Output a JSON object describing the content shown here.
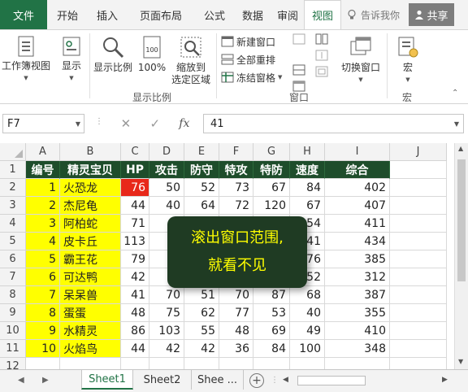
{
  "tabs": {
    "file": "文件",
    "items": [
      "开始",
      "插入",
      "页面布局",
      "公式",
      "数据",
      "审阅",
      "视图"
    ],
    "active": "视图",
    "tell_me": "告诉我你",
    "share": "共享"
  },
  "ribbon": {
    "workbook_views": "工作簿视图",
    "show": "显示",
    "zoom": "显示比例",
    "zoom_100": "100%",
    "zoom_to_selection": [
      "缩放到",
      "选定区域"
    ],
    "zoom_group": "显示比例",
    "new_window": "新建窗口",
    "arrange_all": "全部重排",
    "freeze_panes": "冻结窗格",
    "switch_windows": "切换窗口",
    "window_group": "窗口",
    "macros": "宏",
    "macros_group": "宏"
  },
  "formula_bar": {
    "name_box": "F7",
    "fx": "fx",
    "value": "41"
  },
  "columns": [
    "A",
    "B",
    "C",
    "D",
    "E",
    "F",
    "G",
    "H",
    "I",
    "J"
  ],
  "rows": [
    "1",
    "2",
    "3",
    "4",
    "5",
    "6",
    "7",
    "8",
    "9",
    "10",
    "11",
    "12"
  ],
  "table": {
    "headers": [
      "编号",
      "精灵宝贝",
      "HP",
      "攻击",
      "防守",
      "特攻",
      "特防",
      "速度",
      "综合"
    ],
    "data": [
      [
        "1",
        "火恐龙",
        "76",
        "50",
        "52",
        "73",
        "67",
        "84",
        "402"
      ],
      [
        "2",
        "杰尼龟",
        "44",
        "40",
        "64",
        "72",
        "120",
        "67",
        "407"
      ],
      [
        "3",
        "阿柏蛇",
        "71",
        "",
        "",
        "",
        "",
        "54",
        "411"
      ],
      [
        "4",
        "皮卡丘",
        "113",
        "",
        "",
        "",
        "",
        "41",
        "434"
      ],
      [
        "5",
        "霸王花",
        "79",
        "",
        "",
        "",
        "",
        "76",
        "385"
      ],
      [
        "6",
        "可达鸭",
        "42",
        "",
        "",
        "",
        "",
        "52",
        "312"
      ],
      [
        "7",
        "呆呆兽",
        "41",
        "70",
        "51",
        "70",
        "87",
        "68",
        "387"
      ],
      [
        "8",
        "蛋蛋",
        "48",
        "75",
        "62",
        "77",
        "53",
        "40",
        "355"
      ],
      [
        "9",
        "水精灵",
        "86",
        "103",
        "55",
        "48",
        "69",
        "49",
        "410"
      ],
      [
        "10",
        "火焰鸟",
        "44",
        "42",
        "42",
        "36",
        "84",
        "100",
        "348"
      ]
    ]
  },
  "overlay": {
    "line1": "滚出窗口范围,",
    "line2": "就看不见"
  },
  "sheets": {
    "tabs": [
      "Sheet1",
      "Sheet2",
      "Shee ..."
    ],
    "active": "Sheet1",
    "add": "+"
  },
  "colors": {
    "excel_green": "#217346",
    "header_fill": "#1e4d2b",
    "highlight_yellow": "#ffff00",
    "hp_red": "#e8281a",
    "overlay_text": "#ffff00"
  }
}
